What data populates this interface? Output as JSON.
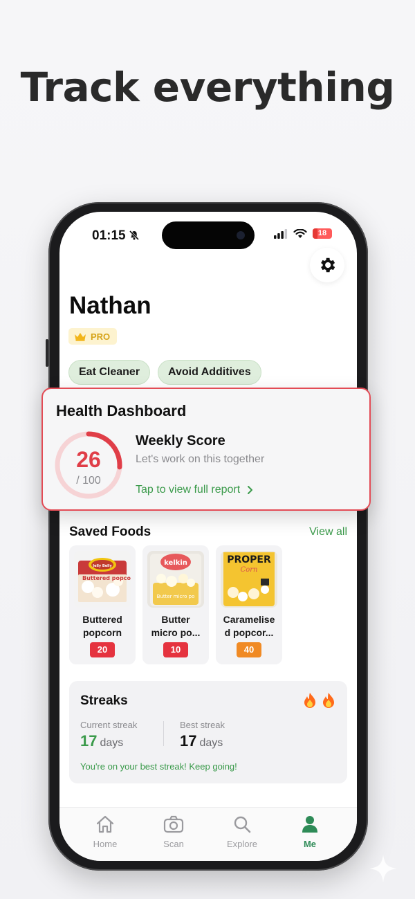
{
  "hero": {
    "title": "Track everything"
  },
  "status_bar": {
    "time": "01:15",
    "battery": "18"
  },
  "profile": {
    "name": "Nathan",
    "badge": "PRO"
  },
  "goals": [
    "Eat Cleaner",
    "Avoid Additives"
  ],
  "dashboard": {
    "title": "Health Dashboard",
    "score": "26",
    "score_max": "/ 100",
    "score_value": 26,
    "weekly_label": "Weekly Score",
    "message": "Let's work on this together",
    "link": "Tap to view full report"
  },
  "saved_foods": {
    "title": "Saved Foods",
    "view_all": "View all",
    "items": [
      {
        "name_line1": "Buttered",
        "name_line2": "popcorn",
        "score": "20",
        "color": "#e5333f",
        "brand": "Jelly Belly",
        "label": "Buttered popcorn"
      },
      {
        "name_line1": "Butter",
        "name_line2": "micro po...",
        "score": "10",
        "color": "#e5333f",
        "brand": "kelkin",
        "label": "Butter micro po"
      },
      {
        "name_line1": "Caramelise",
        "name_line2": "d popcor...",
        "score": "40",
        "color": "#f08a24",
        "brand": "PROPER",
        "label": "Corn"
      }
    ]
  },
  "streaks": {
    "title": "Streaks",
    "current_label": "Current streak",
    "current_value": "17",
    "best_label": "Best streak",
    "best_value": "17",
    "unit": "days",
    "message": "You're on your best streak! Keep going!"
  },
  "tabs": [
    {
      "label": "Home",
      "icon": "home-icon"
    },
    {
      "label": "Scan",
      "icon": "camera-icon"
    },
    {
      "label": "Explore",
      "icon": "search-icon"
    },
    {
      "label": "Me",
      "icon": "person-icon",
      "active": true
    }
  ],
  "colors": {
    "accent_green": "#3a9a4a",
    "score_red": "#e03e48",
    "score_orange": "#f08a24"
  }
}
